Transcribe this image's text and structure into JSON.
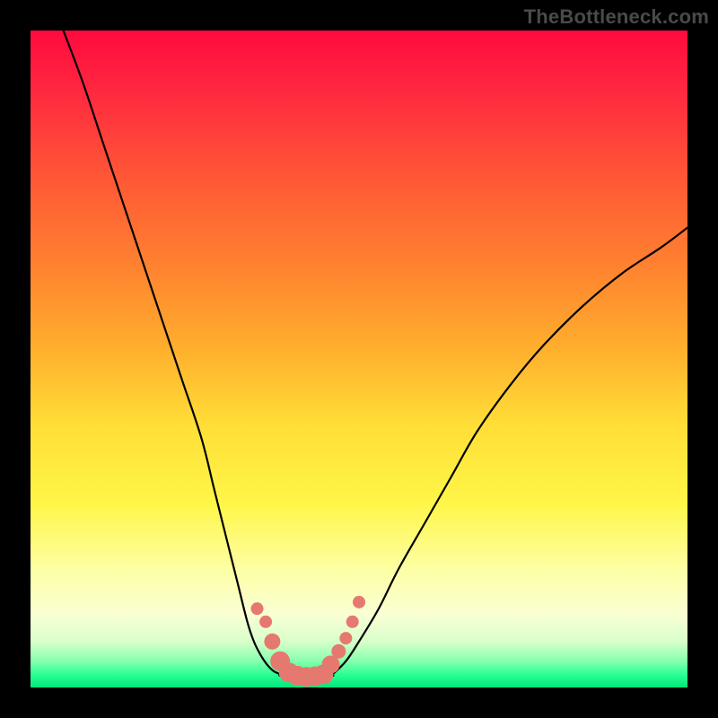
{
  "watermark": "TheBottleneck.com",
  "colors": {
    "frame": "#000000",
    "curve": "#000000",
    "marker_fill": "#e6796f",
    "marker_stroke": "#d45e56"
  },
  "chart_data": {
    "type": "line",
    "title": "",
    "xlabel": "",
    "ylabel": "",
    "xlim": [
      0,
      100
    ],
    "ylim": [
      0,
      100
    ],
    "series": [
      {
        "name": "left-curve",
        "x": [
          5,
          8,
          11,
          14,
          17,
          20,
          23,
          26,
          28,
          30,
          31.5,
          33,
          34,
          35,
          36,
          37,
          38
        ],
        "y": [
          100,
          92,
          83,
          74,
          65,
          56,
          47,
          38,
          30,
          22,
          16,
          10,
          7,
          5,
          3.5,
          2.5,
          2
        ]
      },
      {
        "name": "valley-floor",
        "x": [
          38,
          40,
          42,
          44,
          46
        ],
        "y": [
          1.8,
          1.5,
          1.5,
          1.6,
          1.8
        ]
      },
      {
        "name": "right-curve",
        "x": [
          46,
          48,
          50,
          53,
          56,
          60,
          64,
          68,
          73,
          78,
          84,
          90,
          96,
          100
        ],
        "y": [
          2,
          4,
          7,
          12,
          18,
          25,
          32,
          39,
          46,
          52,
          58,
          63,
          67,
          70
        ]
      }
    ],
    "markers": {
      "name": "valley-markers",
      "x": [
        34.5,
        35.8,
        36.8,
        38.0,
        39.3,
        40.6,
        42.0,
        43.3,
        44.6,
        45.7,
        46.9,
        48.0,
        49.0,
        50.0
      ],
      "y": [
        12.0,
        10.0,
        7.0,
        4.0,
        2.3,
        1.8,
        1.6,
        1.7,
        2.0,
        3.5,
        5.5,
        7.5,
        10.0,
        13.0
      ],
      "r": [
        7,
        7,
        9,
        11,
        11,
        11,
        11,
        11,
        11,
        10,
        8,
        7,
        7,
        7
      ]
    }
  }
}
